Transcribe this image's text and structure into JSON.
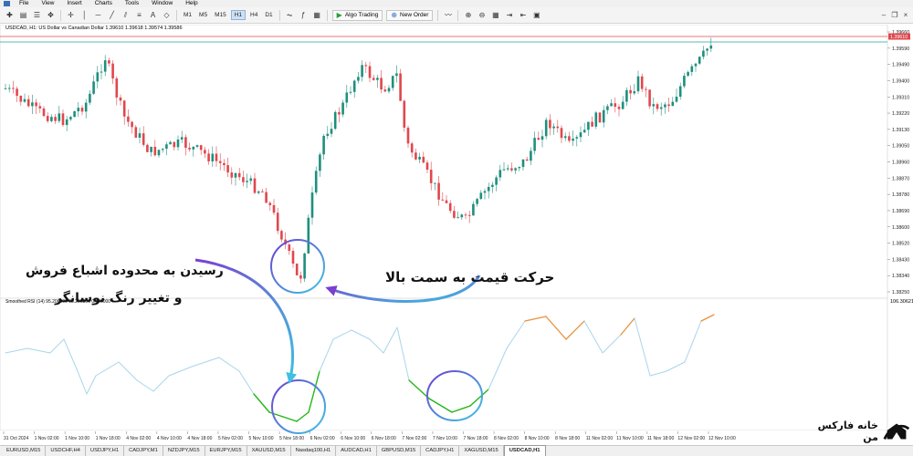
{
  "menu": {
    "items": [
      "File",
      "View",
      "Insert",
      "Charts",
      "Tools",
      "Window",
      "Help"
    ]
  },
  "toolbar": {
    "timeframes": [
      "M1",
      "M5",
      "M15",
      "H1",
      "H4",
      "D1"
    ],
    "active_timeframe": "H1",
    "algo_trading_label": "Algo Trading",
    "new_order_label": "New Order"
  },
  "chart": {
    "header": "USDCAD, H1:  US Dollar vs Canadian Dollar  1.39610 1.39618 1.39574 1.39586",
    "price_labels": [
      "1.39660",
      "1.39590",
      "1.39490",
      "1.39400",
      "1.39310",
      "1.39220",
      "1.39130",
      "1.39050",
      "1.38960",
      "1.38870",
      "1.38780",
      "1.38690",
      "1.38600",
      "1.38520",
      "1.38430",
      "1.38340",
      "1.38250"
    ],
    "current_price_tag": "1.39610",
    "colors": {
      "bull": "#1e8f7e",
      "bear": "#e0474c",
      "bid_line": "#e0474c",
      "ask_line": "#2aa198"
    }
  },
  "rsi": {
    "header": "Smoothed RSI (14) 95.206396 95.206396 0.000000",
    "top_label": "106.306215",
    "colors": {
      "neutral": "#a8d5ec",
      "overbought": "#e8913a",
      "oversold": "#22b518"
    }
  },
  "date_axis": [
    "31 Oct 2024",
    "1 Nov 02:00",
    "1 Nov 10:00",
    "1 Nov 18:00",
    "4 Nov 02:00",
    "4 Nov 10:00",
    "4 Nov 18:00",
    "5 Nov 02:00",
    "5 Nov 10:00",
    "5 Nov 18:00",
    "6 Nov 02:00",
    "6 Nov 10:00",
    "6 Nov 18:00",
    "7 Nov 02:00",
    "7 Nov 10:00",
    "7 Nov 18:00",
    "8 Nov 02:00",
    "8 Nov 10:00",
    "8 Nov 18:00",
    "11 Nov 02:00",
    "11 Nov 10:00",
    "11 Nov 18:00",
    "12 Nov 02:00",
    "12 Nov 10:00"
  ],
  "symbol_tabs": [
    "EURUSD,M15",
    "USDCHF,H4",
    "USDJPY,H1",
    "CADJPY,M1",
    "NZDJPY,M15",
    "EURJPY,M15",
    "XAUUSD,M15",
    "Nasdaq100,H1",
    "AUDCAD,H1",
    "GBPUSD,M15",
    "CADJPY,H1",
    "XAGUSD,M15",
    "USDCAD,H1"
  ],
  "active_symbol": "USDCAD,H1",
  "annotations": {
    "oversold_line1": "رسیدن به محدوده اشباع فروش",
    "oversold_line2": "و تغییر رنگ نوسانگر",
    "price_up": "حرکت قیمت به سمت بالا"
  },
  "logo": {
    "text": "خانه فارکس من"
  }
}
